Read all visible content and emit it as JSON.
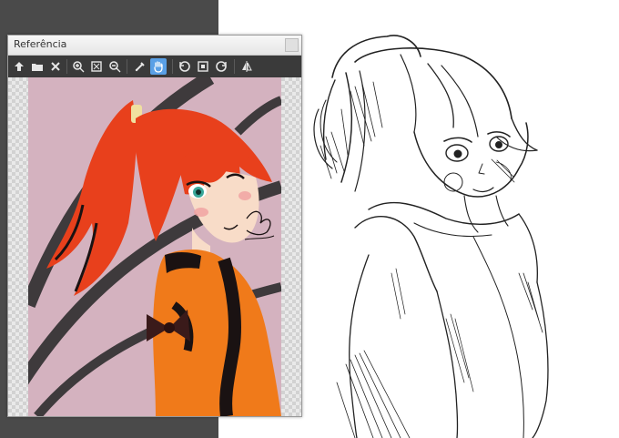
{
  "reference_window": {
    "title": "Referência"
  },
  "toolbar": {
    "buttons": [
      {
        "icon": "import-icon"
      },
      {
        "icon": "open-folder-icon"
      },
      {
        "icon": "clear-icon"
      },
      {
        "icon": "zoom-in-icon"
      },
      {
        "icon": "fit-to-window-icon"
      },
      {
        "icon": "zoom-out-icon"
      },
      {
        "icon": "eyedropper-icon"
      },
      {
        "icon": "hand-pan-icon",
        "active": true
      },
      {
        "icon": "rotate-left-icon"
      },
      {
        "icon": "reset-view-icon"
      },
      {
        "icon": "rotate-right-icon"
      },
      {
        "icon": "flip-horizontal-icon"
      }
    ]
  },
  "colors": {
    "workspace": "#4a4a4a",
    "toolbar": "#3a3a3a",
    "active_tool": "#5aa0e6",
    "reference_background": "#d4b2bf",
    "hair": "#e8401c",
    "jacket": "#f07a1a"
  }
}
